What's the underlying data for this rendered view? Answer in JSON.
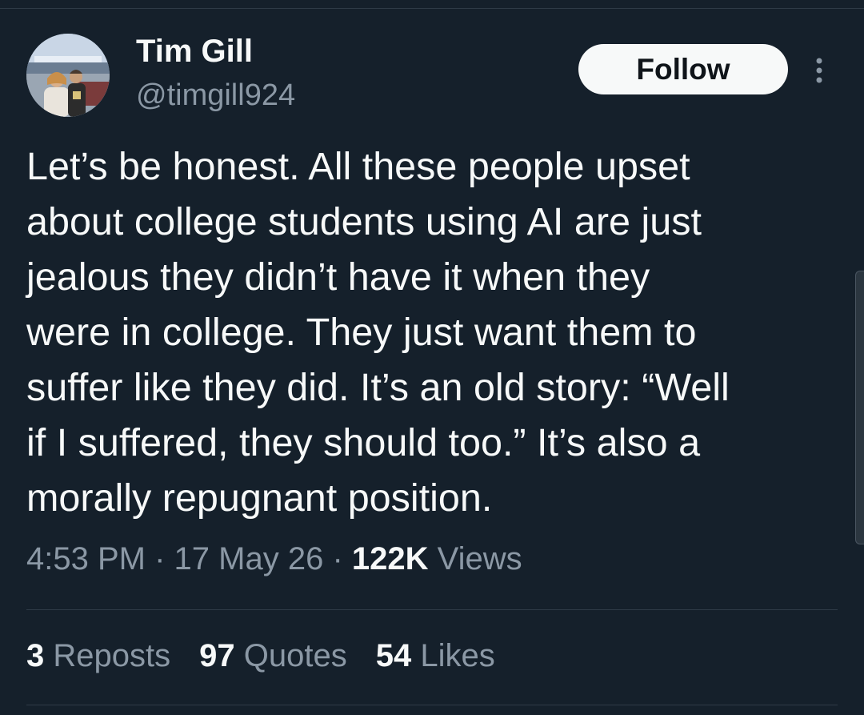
{
  "author": {
    "display_name": "Tim Gill",
    "handle": "@timgill924"
  },
  "actions": {
    "follow_label": "Follow"
  },
  "tweet": {
    "text": "Let’s be honest. All these people upset\nabout college students using AI are just\njealous they didn’t have it when they\nwere in college. They just want them to\nsuffer like they did. It’s an old story: “Well\nif I suffered, they should too.” It’s also a\nmorally repugnant position.",
    "time": "4:53 PM",
    "date": "17 May 26",
    "separator": "·",
    "views_count": "122K",
    "views_label": "Views"
  },
  "stats": {
    "reposts_count": "3",
    "reposts_label": "Reposts",
    "quotes_count": "97",
    "quotes_label": "Quotes",
    "likes_count": "54",
    "likes_label": "Likes"
  },
  "colors": {
    "background": "#15202b",
    "text_primary": "#f7f9f9",
    "text_secondary": "#8b98a5",
    "divider": "#2f3b47",
    "follow_button_bg": "#f7f9f9",
    "follow_button_text": "#0f1419"
  },
  "icons": {
    "more": "more-vertical-icon",
    "avatar": "avatar-photo"
  }
}
